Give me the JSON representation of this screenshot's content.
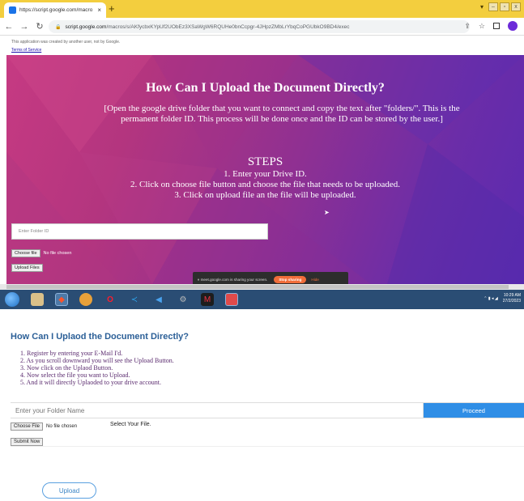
{
  "browser": {
    "tab_title": "https://script.google.com/macro...",
    "tab_close": "×",
    "new_tab": "+",
    "url_host": "script.google.com",
    "url_path": "/macros/s/AKfycbxKYpUf2UObEz3XSaWgW6RQUHe0bnCcpgr-4JHpzZMbLrYbqCoPGUbkO9BD4/exec",
    "win_minimize": "–",
    "win_restore": "▫",
    "win_close": "x"
  },
  "google_bar": {
    "notice": "This application was created by another user, not by Google.",
    "terms": "Terms of Service"
  },
  "app": {
    "heading": "How Can I Upload the Document Directly?",
    "paragraph": "[Open the google drive folder that you want to connect and copy the text after \"folders/\". This is the permanent folder ID. This process will be done once and the ID can be stored by the user.]",
    "steps_title": "STEPS",
    "steps": [
      "1. Enter your Drive ID.",
      "2. Click on choose file button and choose the file  that needs to be uploaded.",
      "3. Click on upload file an the file will be uploaded."
    ],
    "folder_placeholder": "Enter Folder ID",
    "choose_file": "Choose file",
    "no_file": "No file chosen",
    "upload_files": "Upload Files"
  },
  "share_bar": {
    "message": "meet.google.com is sharing your screen.",
    "stop": "Stop sharing",
    "hide": "Hide"
  },
  "tray": {
    "time": "10:29 AM",
    "date": "27/2/2023"
  },
  "page2": {
    "title": "How Can I Uplaod the Document Directly?",
    "steps": [
      "1. Register by entering your E-Mail I'd.",
      "2. As you scroll downward you will see the Upload Button.",
      "3. Now click on the Uplaod Button.",
      "4. Now select the file you want to Upload.",
      "5. And it will directly Uplaoded to your drive account."
    ],
    "folder_placeholder": "Enter your Folder Name",
    "proceed": "Proceed",
    "choose_file": "Choose File",
    "no_file": "No file chosen",
    "select_label": "Select Your File.",
    "submit": "Submit Now",
    "upload": "Upload"
  },
  "colors": {
    "tabbar": "#f3ce3e",
    "app_gradient_start": "#c63a82",
    "app_gradient_end": "#5a2ab0",
    "taskbar": "#2a4d74",
    "proceed_button": "#2f8ee6",
    "page2_title": "#2b5f97",
    "page2_steps": "#5a2a6e",
    "stop_sharing": "#f06d3a"
  }
}
